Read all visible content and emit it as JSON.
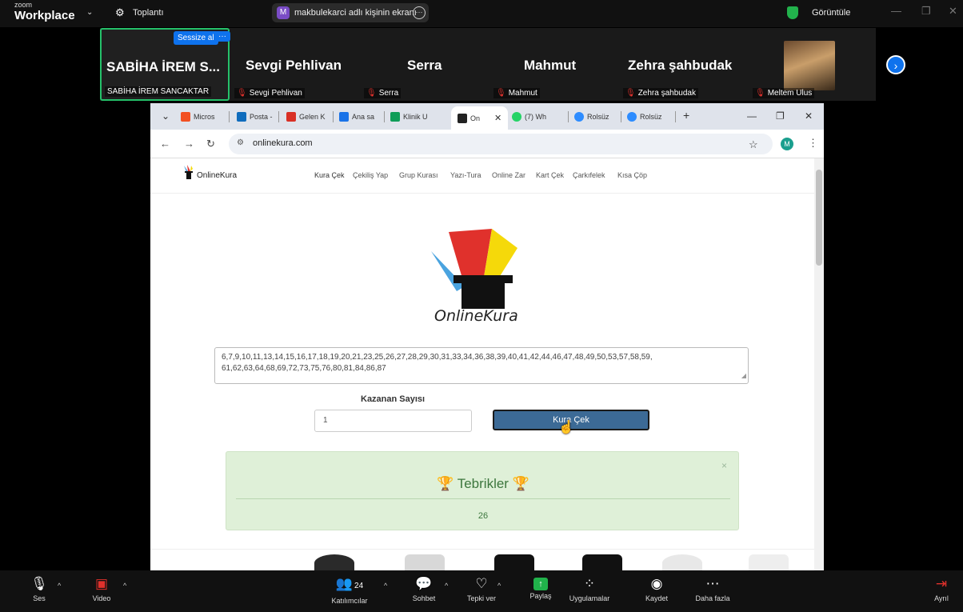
{
  "zoom": {
    "brand_small": "zoom",
    "brand_big": "Workplace",
    "meeting_label": "Toplantı",
    "share_avatar": "M",
    "share_text": "makbulekarci adlı kişinin ekranı",
    "view_label": "Görüntüle"
  },
  "gallery": {
    "active": {
      "name": "SABİHA İREM S...",
      "label": "SABİHA İREM SANCAKTAR",
      "mute_all": "Sessize al",
      "more": "···"
    },
    "tiles": [
      {
        "name": "Sevgi Pehlivan",
        "label": "Sevgi Pehlivan"
      },
      {
        "name": "Serra",
        "label": "Serra"
      },
      {
        "name": "Mahmut",
        "label": "Mahmut"
      },
      {
        "name": "Zehra şahbudak",
        "label": "Zehra şahbudak"
      }
    ],
    "video_tile_label": "Meltem Ulus"
  },
  "browser": {
    "tabs": [
      {
        "label": "Micros",
        "color": "#f25022"
      },
      {
        "label": "Posta -",
        "color": "#0f6cbd"
      },
      {
        "label": "Gelen K",
        "color": "#d93025"
      },
      {
        "label": "Ana sa",
        "color": "#1a73e8"
      },
      {
        "label": "Klinik U",
        "color": "#0f9d58"
      },
      {
        "label": "On",
        "color": "#222222"
      },
      {
        "label": "(7) Wh",
        "color": "#25d366"
      },
      {
        "label": "Rolsüz",
        "color": "#2d8cff"
      },
      {
        "label": "Rolsüz",
        "color": "#2d8cff"
      }
    ],
    "url": "onlinekura.com",
    "profile_initial": "M"
  },
  "site": {
    "name": "OnlineKura",
    "menu": [
      "Kura Çek",
      "Çekiliş Yap",
      "Grup Kurası",
      "Yazı-Tura",
      "Online Zar",
      "Kart Çek",
      "Çarkıfelek",
      "Kısa Çöp"
    ],
    "hero_text": "OnlineKura",
    "numbers_line1": "6,7,9,10,11,13,14,15,16,17,18,19,20,21,23,25,26,27,28,29,30,31,33,34,36,38,39,40,41,42,44,46,47,48,49,50,53,57,58,59,",
    "numbers_line2": "61,62,63,64,68,69,72,73,75,76,80,81,84,86,87",
    "winners_label": "Kazanan Sayısı",
    "winners_value": "1",
    "draw_button": "Kura Çek",
    "result_title": "Tebrikler",
    "result_value": "26"
  },
  "toolbar": {
    "audio": "Ses",
    "video": "Video",
    "participants": "Katılımcılar",
    "participants_count": "24",
    "chat": "Sohbet",
    "react": "Tepki ver",
    "share": "Paylaş",
    "apps": "Uygulamalar",
    "record": "Kaydet",
    "more": "Daha fazla",
    "leave": "Ayrıl"
  },
  "colors": {
    "zoom_blue": "#0e72ed",
    "active_border": "#25c16a",
    "mute_red": "#e0312c",
    "share_green": "#21b24b",
    "draw_button_bg": "#3c6a96",
    "success_bg": "#dff0d8",
    "success_text": "#3c763d"
  },
  "icons": {
    "search": "search-icon",
    "mic": "microphone-icon",
    "video_off": "video-off-icon",
    "participants": "participants-icon",
    "chat": "chat-icon",
    "react": "heart-icon",
    "share": "share-screen-icon",
    "apps": "apps-icon",
    "record": "record-icon",
    "more": "more-icon",
    "leave": "leave-icon",
    "trophy": "trophy-icon"
  }
}
